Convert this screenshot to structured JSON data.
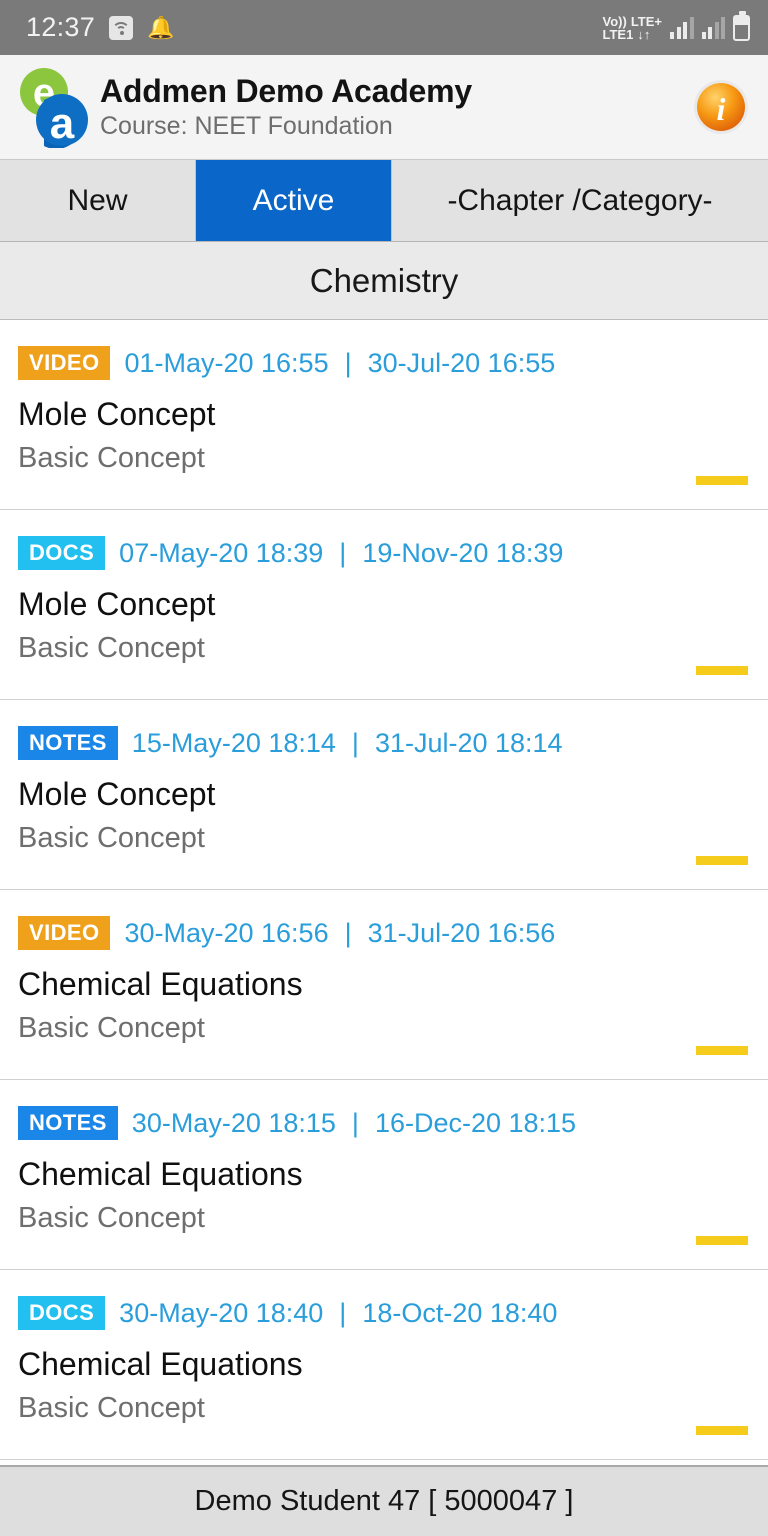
{
  "status_bar": {
    "time": "12:37",
    "wifi_icon": "wifi-icon",
    "notification_icon": "bell-icon",
    "volte_label": "Vo))",
    "network_label_1": "LTE1",
    "network_label_2": "LTE+",
    "data_arrows": "↓↑",
    "signal_icon_1": "signal-bars-icon",
    "signal_icon_2": "signal-bars-icon",
    "battery_icon": "battery-icon"
  },
  "header": {
    "logo_icon": "addmen-ea-logo-icon",
    "title": "Addmen Demo Academy",
    "subtitle": "Course: NEET Foundation",
    "info_icon": "info-icon"
  },
  "tabs": [
    {
      "label": "New",
      "selected": false
    },
    {
      "label": "Active",
      "selected": true
    },
    {
      "label": "-Chapter /Category-",
      "selected": false
    }
  ],
  "subject_header": "Chemistry",
  "items": [
    {
      "type": "VIDEO",
      "type_class": "video",
      "start_date": "01-May-20 16:55",
      "separator": "|",
      "end_date": "30-Jul-20 16:55",
      "title": "Mole Concept",
      "subtitle": "Basic Concept",
      "progress_indicator": "progress-bar"
    },
    {
      "type": "DOCS",
      "type_class": "docs",
      "start_date": "07-May-20 18:39",
      "separator": "|",
      "end_date": "19-Nov-20 18:39",
      "title": "Mole Concept",
      "subtitle": "Basic Concept",
      "progress_indicator": "progress-bar"
    },
    {
      "type": "NOTES",
      "type_class": "notes",
      "start_date": "15-May-20 18:14",
      "separator": "|",
      "end_date": "31-Jul-20 18:14",
      "title": "Mole Concept",
      "subtitle": "Basic Concept",
      "progress_indicator": "progress-bar"
    },
    {
      "type": "VIDEO",
      "type_class": "video",
      "start_date": "30-May-20 16:56",
      "separator": "|",
      "end_date": "31-Jul-20 16:56",
      "title": "Chemical Equations",
      "subtitle": "Basic Concept",
      "progress_indicator": "progress-bar"
    },
    {
      "type": "NOTES",
      "type_class": "notes",
      "start_date": "30-May-20 18:15",
      "separator": "|",
      "end_date": "16-Dec-20 18:15",
      "title": "Chemical Equations",
      "subtitle": "Basic Concept",
      "progress_indicator": "progress-bar"
    },
    {
      "type": "DOCS",
      "type_class": "docs",
      "start_date": "30-May-20 18:40",
      "separator": "|",
      "end_date": "18-Oct-20 18:40",
      "title": "Chemical Equations",
      "subtitle": "Basic Concept",
      "progress_indicator": "progress-bar"
    }
  ],
  "footer": {
    "student": "Demo Student 47 [ 5000047 ]"
  },
  "colors": {
    "status_bar_bg": "#7a7a7a",
    "header_bg": "#f4f4f4",
    "tab_active_bg": "#0a66c8",
    "tab_inactive_bg": "#e2e2e2",
    "subject_bg": "#eaeaea",
    "badge_video": "#f0a11c",
    "badge_docs": "#22c0f0",
    "badge_notes": "#1a86e8",
    "date_text": "#2a9ddb",
    "progress": "#f5cc1b",
    "footer_bg": "#dedede"
  }
}
